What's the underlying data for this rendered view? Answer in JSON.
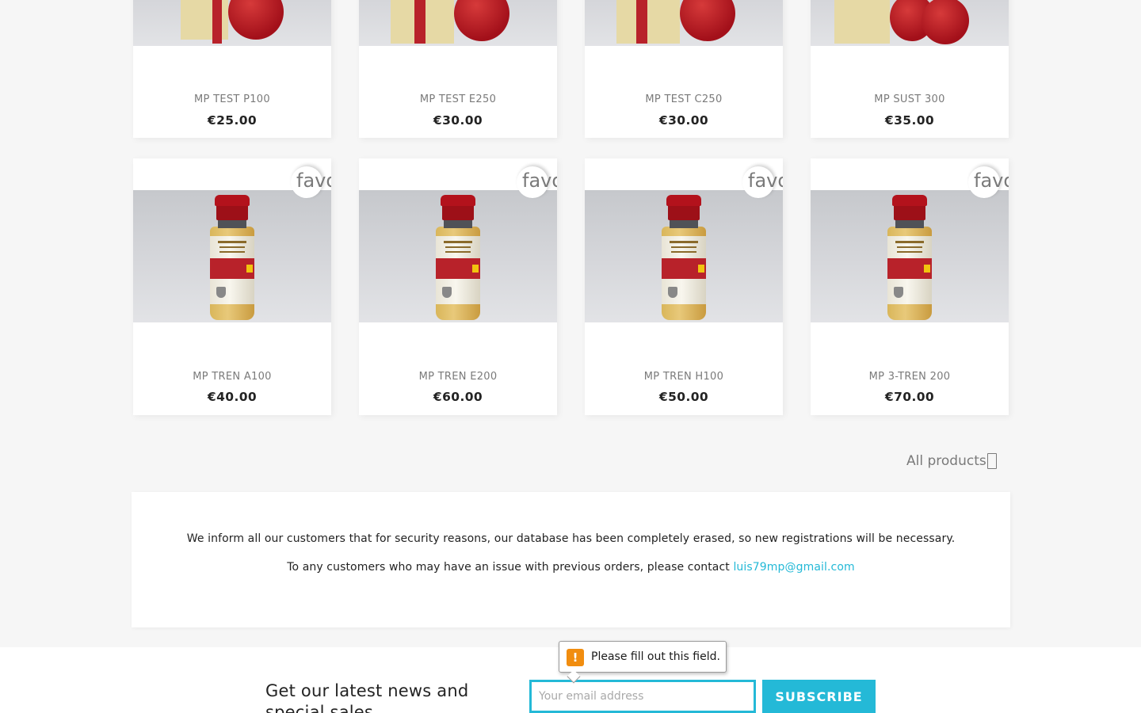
{
  "products_row1": [
    {
      "name": "MP TEST P100",
      "price": "€25.00"
    },
    {
      "name": "MP TEST E250",
      "price": "€30.00"
    },
    {
      "name": "MP TEST C250",
      "price": "€30.00"
    },
    {
      "name": "MP SUST 300",
      "price": "€35.00"
    }
  ],
  "products_row2": [
    {
      "name": "MP TREN A100",
      "price": "€40.00",
      "favorite_label": "favorite_border"
    },
    {
      "name": "MP TREN E200",
      "price": "€60.00",
      "favorite_label": "favorite_border"
    },
    {
      "name": "MP TREN H100",
      "price": "€50.00",
      "favorite_label": "favorite_border"
    },
    {
      "name": "MP 3-TREN 200",
      "price": "€70.00",
      "favorite_label": "favorite_border"
    }
  ],
  "all_products": {
    "label": "All products"
  },
  "notice": {
    "line1": "We inform all our customers that for security reasons, our database has been completely erased, so new registrations will be necessary.",
    "line2_prefix": "To any customers who may have an issue with previous orders, please contact",
    "email": "luis79mp@gmail.com"
  },
  "newsletter": {
    "title": "Get our latest news and special sales",
    "email_placeholder": "Your email address",
    "subscribe_label": "SUBSCRIBE",
    "validation_message": "Please fill out this field."
  },
  "colors": {
    "accent": "#24b9d7",
    "warning": "#f18d0f"
  }
}
